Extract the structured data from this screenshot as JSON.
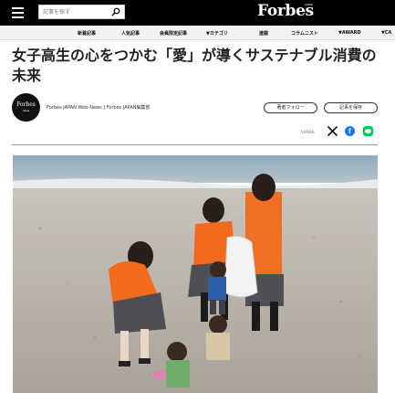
{
  "header": {
    "search_placeholder": "記事を探す",
    "logo": "Forbes",
    "logo_sub": "JAPAN"
  },
  "nav": {
    "items": [
      "新着記事",
      "人気記事",
      "会員限定記事",
      "▼カテゴリ",
      "連載",
      "コラムニスト",
      "▼AWARD",
      "▼CA"
    ]
  },
  "article": {
    "title": "女子高生の心をつかむ「愛」が導くサステナブル消費の未来",
    "avatar_main": "Forbes",
    "avatar_sub": "news",
    "author": "Forbes JAPAN Web-News | Forbes JAPAN編集部",
    "follow_label": "著者フォロー",
    "save_label": "記事を保存",
    "share_label": "SHARE"
  },
  "colors": {
    "header_bg": "#000000",
    "facebook": "#1877f2",
    "line": "#06c755",
    "vest": "#f26a1b"
  },
  "icons": [
    "menu-icon",
    "search-icon",
    "x-icon",
    "facebook-icon",
    "line-icon"
  ]
}
